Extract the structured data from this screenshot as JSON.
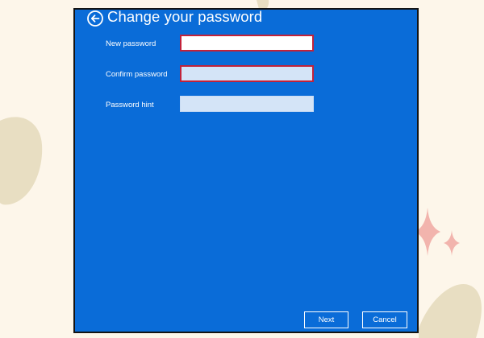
{
  "dialog": {
    "title": "Change your password",
    "back_icon": "back-arrow-icon",
    "fields": {
      "new_password": {
        "label": "New password",
        "value": ""
      },
      "confirm_password": {
        "label": "Confirm password",
        "value": ""
      },
      "password_hint": {
        "label": "Password hint",
        "value": ""
      }
    },
    "buttons": {
      "next": "Next",
      "cancel": "Cancel"
    }
  },
  "colors": {
    "window_background": "#0a6cd8",
    "page_background": "#fdf6ea",
    "error_border": "#c2223a",
    "input_fill_light": "#d4e4f7",
    "decor_blob": "#e8dec2",
    "decor_sparkle": "#f2b4ad"
  }
}
